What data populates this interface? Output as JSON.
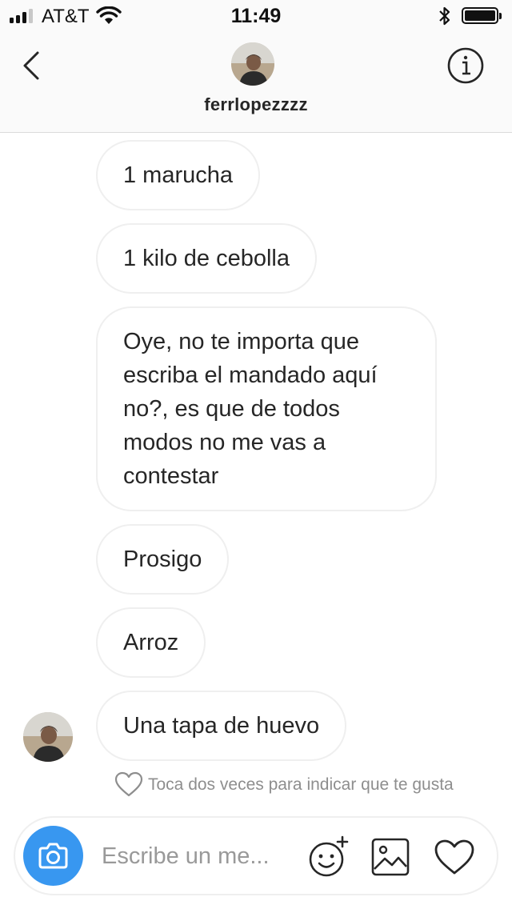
{
  "status_bar": {
    "carrier": "AT&T",
    "time": "11:49"
  },
  "header": {
    "username": "ferrlopezzzz"
  },
  "messages": [
    {
      "text": "1 marucha"
    },
    {
      "text": "1 kilo de cebolla"
    },
    {
      "text": "Oye, no te importa que escriba el mandado aquí no?, es que de todos modos no me vas a contestar"
    },
    {
      "text": "Prosigo"
    },
    {
      "text": "Arroz"
    },
    {
      "text": "Una tapa de huevo"
    }
  ],
  "hint": "Toca dos veces para indicar que te gusta",
  "composer": {
    "placeholder": "Escribe un me..."
  },
  "colors": {
    "accent": "#3897f0",
    "bubble_border": "#efefef",
    "hint_text": "#8e8e8e"
  },
  "icons": [
    "signal-icon",
    "wifi-icon",
    "bluetooth-icon",
    "battery-icon",
    "back-chevron-icon",
    "info-icon",
    "camera-icon",
    "emoji-sticker-icon",
    "gallery-icon",
    "heart-icon"
  ]
}
